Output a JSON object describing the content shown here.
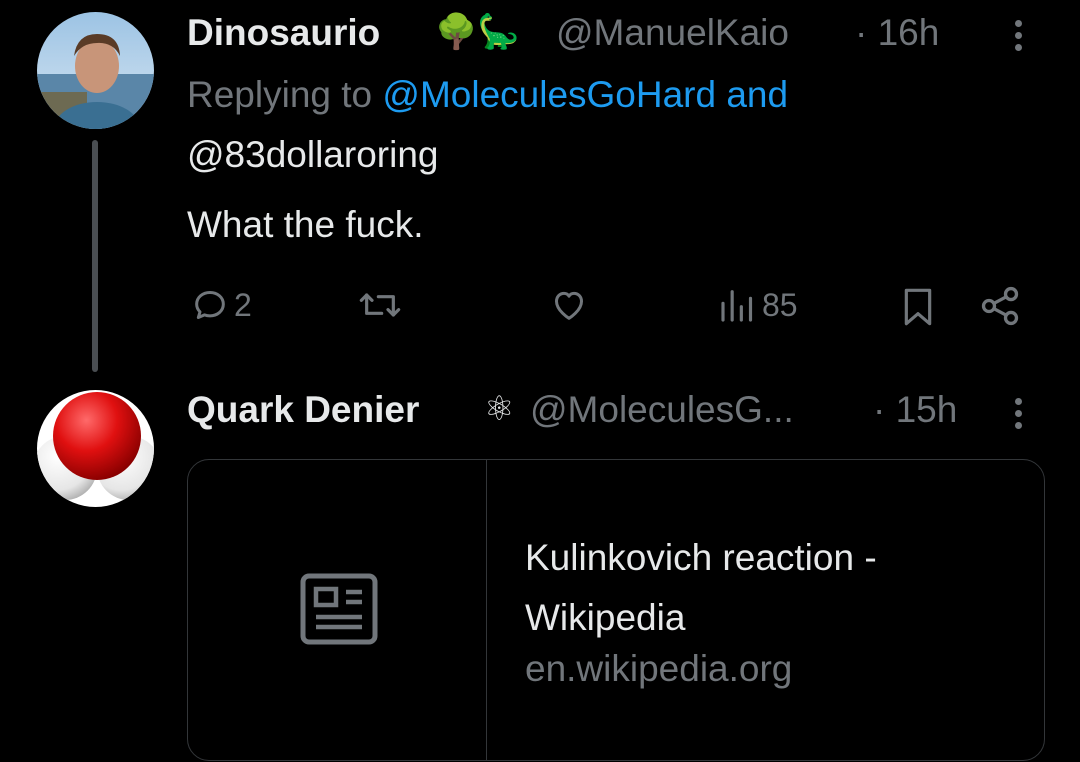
{
  "tweet1": {
    "name": "Dinosaurio",
    "emoji": "🌳🦕",
    "handle": "@ManuelKaio",
    "time": "· 16h",
    "reply_prefix": "Replying to ",
    "reply_to_1": "@MoleculesGoHard",
    "reply_and": " and",
    "reply_to_2": "@83dollaroring",
    "text": "What the fuck.",
    "replies": "2",
    "retweets": "",
    "likes": "",
    "views": "85"
  },
  "tweet2": {
    "name": "Quark Denier",
    "emoji": "⚛",
    "handle": "@MoleculesG...",
    "time": "· 15h",
    "card": {
      "title_line1": "Kulinkovich reaction -",
      "title_line2": "Wikipedia",
      "domain": "en.wikipedia.org"
    }
  },
  "colors": {
    "background": "#000000",
    "text": "#e7e9ea",
    "secondary": "#71767b",
    "link": "#1d9bf0",
    "border": "#333639"
  }
}
